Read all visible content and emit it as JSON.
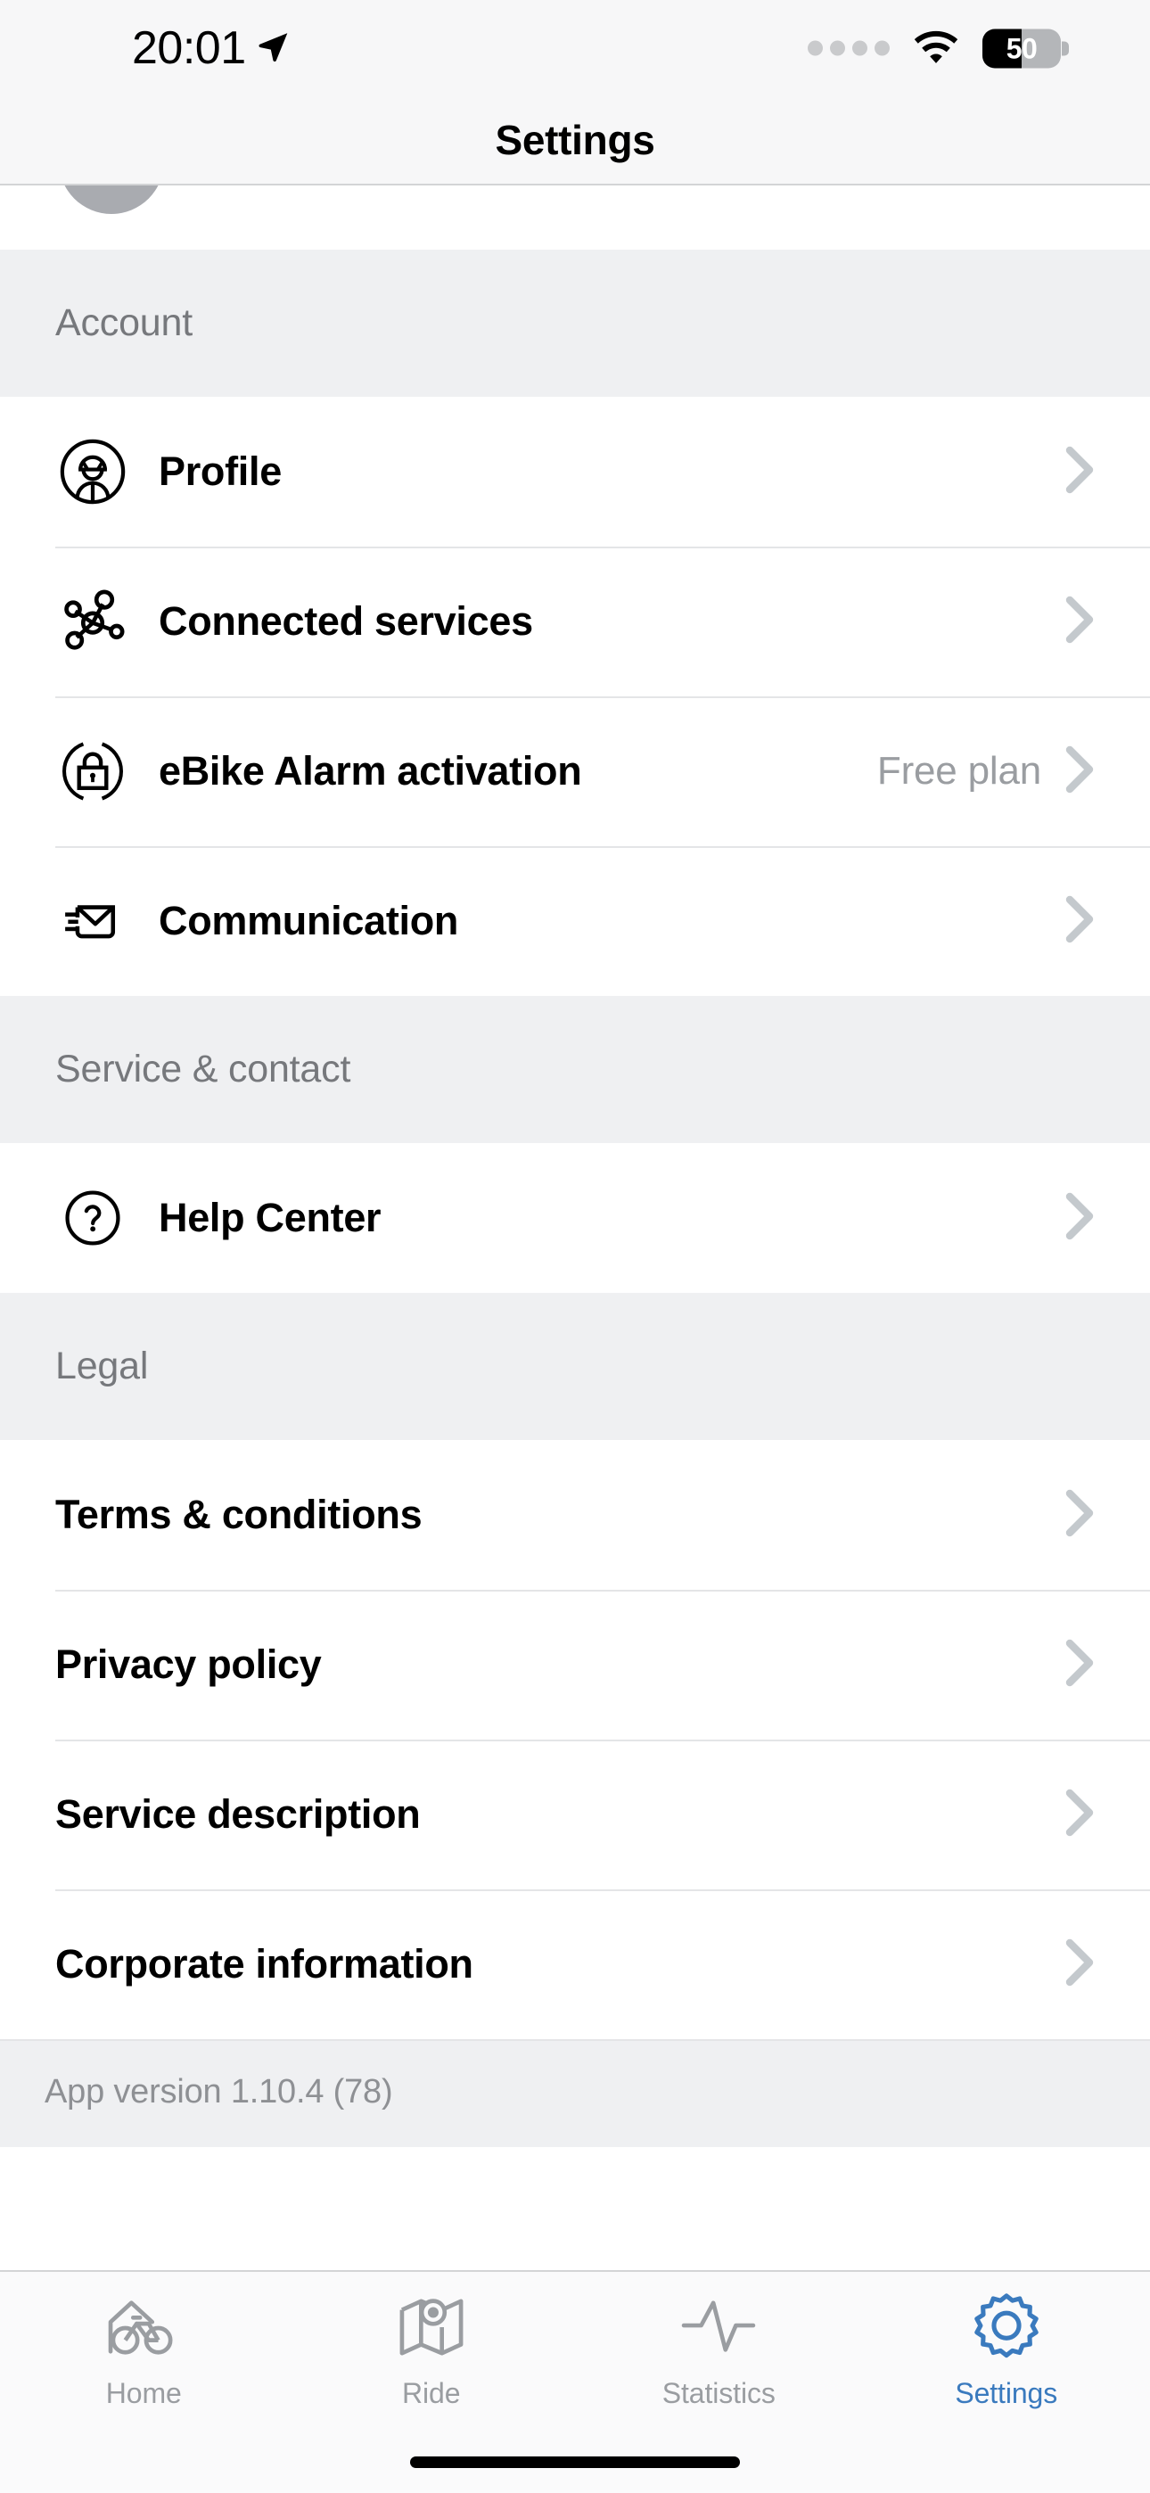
{
  "status_bar": {
    "time": "20:01",
    "location_icon": "location-arrow-icon",
    "signal_icon": "cellular-dots-icon",
    "wifi_icon": "wifi-icon",
    "battery_percent": "50",
    "battery_level": 50
  },
  "nav": {
    "title": "Settings"
  },
  "sections": [
    {
      "header": "Account",
      "has_icons": true,
      "rows": [
        {
          "icon": "profile-helmet-icon",
          "label": "Profile",
          "value": ""
        },
        {
          "icon": "network-nodes-icon",
          "label": "Connected services",
          "value": ""
        },
        {
          "icon": "padlock-circle-icon",
          "label": "eBike Alarm activation",
          "value": "Free plan"
        },
        {
          "icon": "envelope-icon",
          "label": "Communication",
          "value": ""
        }
      ]
    },
    {
      "header": "Service & contact",
      "has_icons": true,
      "rows": [
        {
          "icon": "question-mark-circle-icon",
          "label": "Help Center",
          "value": ""
        }
      ]
    },
    {
      "header": "Legal",
      "has_icons": false,
      "rows": [
        {
          "icon": "",
          "label": "Terms & conditions",
          "value": ""
        },
        {
          "icon": "",
          "label": "Privacy policy",
          "value": ""
        },
        {
          "icon": "",
          "label": "Service description",
          "value": ""
        },
        {
          "icon": "",
          "label": "Corporate information",
          "value": ""
        }
      ]
    }
  ],
  "footer": {
    "app_version": "App version 1.10.4 (78)"
  },
  "tab_bar": {
    "active_color": "#3a7abe",
    "inactive_color": "#9a9da1",
    "tabs": [
      {
        "icon": "home-bike-icon",
        "label": "Home",
        "active": false
      },
      {
        "icon": "map-pin-icon",
        "label": "Ride",
        "active": false
      },
      {
        "icon": "pulse-line-icon",
        "label": "Statistics",
        "active": false
      },
      {
        "icon": "gear-icon",
        "label": "Settings",
        "active": true
      }
    ]
  },
  "colors": {
    "section_header_bg": "#eff0f2",
    "row_bg": "#ffffff",
    "divider": "#e4e5e7",
    "chevron": "#c4c9cd",
    "secondary_text": "#9a9da1",
    "accent": "#3a7abe"
  }
}
